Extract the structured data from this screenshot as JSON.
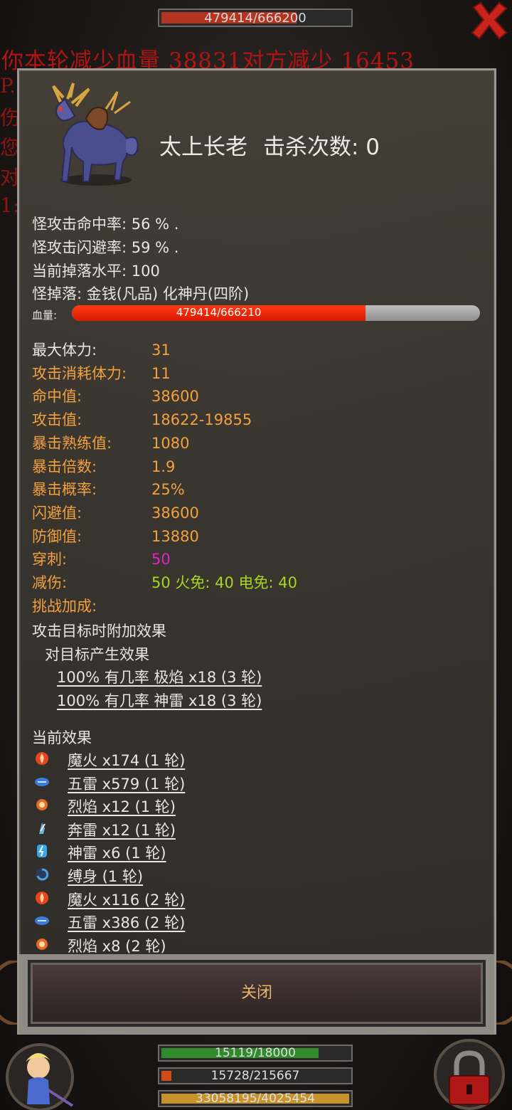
{
  "top_bar": {
    "hp_text": "479414/666200"
  },
  "background_text": {
    "combat_line": "你本轮减少血量   38831对方减少   16453",
    "side_chars": [
      "P.",
      "伤",
      "您",
      "对",
      "1:"
    ]
  },
  "monster": {
    "name": "太上长老",
    "kill_label": "击杀次数: 0",
    "info": [
      "怪攻击命中率: 56 % .",
      "怪攻击闪避率: 59 % .",
      "当前掉落水平: 100",
      "怪掉落: 金钱(凡品) 化神丹(四阶)"
    ],
    "hp_label": "血量:",
    "hp_text": "479414/666210",
    "hp_fraction": 0.72
  },
  "stats": [
    {
      "key": "最大体力:",
      "value": "31",
      "key_color": "white",
      "value_color": "orange"
    },
    {
      "key": "攻击消耗体力:",
      "value": "11",
      "key_color": "orange",
      "value_color": "orange"
    },
    {
      "key": "命中值:",
      "value": "38600",
      "key_color": "orange",
      "value_color": "orange"
    },
    {
      "key": "攻击值:",
      "value": "18622-19855",
      "key_color": "orange",
      "value_color": "orange"
    },
    {
      "key": "暴击熟练值:",
      "value": "1080",
      "key_color": "orange",
      "value_color": "orange"
    },
    {
      "key": "暴击倍数:",
      "value": "1.9",
      "key_color": "orange",
      "value_color": "orange"
    },
    {
      "key": "暴击概率:",
      "value": "25%",
      "key_color": "orange",
      "value_color": "orange"
    },
    {
      "key": "闪避值:",
      "value": "38600",
      "key_color": "orange",
      "value_color": "orange"
    },
    {
      "key": "防御值:",
      "value": "13880",
      "key_color": "orange",
      "value_color": "orange"
    },
    {
      "key": "穿刺:",
      "value": "50",
      "key_color": "orange",
      "value_color": "magenta"
    },
    {
      "key": "减伤:",
      "value": "50 火免: 40 电免: 40",
      "key_color": "orange",
      "value_color": "green"
    },
    {
      "key": "挑战加成:",
      "value": "",
      "key_color": "orange",
      "value_color": "orange"
    }
  ],
  "attack_effects": {
    "title": "攻击目标时附加效果",
    "subtitle": "对目标产生效果",
    "items": [
      "100% 有几率 极焰 x18 (3 轮)",
      "100% 有几率 神雷 x18 (3 轮)"
    ]
  },
  "current_effects": {
    "title": "当前效果",
    "items": [
      {
        "icon": "demon-fire-icon",
        "color": "#e8451f",
        "label": "魔火 x174 (1 轮)"
      },
      {
        "icon": "five-thunder-icon",
        "color": "#3d7be0",
        "label": "五雷 x579 (1 轮)"
      },
      {
        "icon": "blaze-icon",
        "color": "#e86a2a",
        "label": "烈焰 x12 (1 轮)"
      },
      {
        "icon": "rushing-thunder-icon",
        "color": "#6fb0d8",
        "label": "奔雷 x12 (1 轮)"
      },
      {
        "icon": "divine-thunder-icon",
        "color": "#39a8e8",
        "label": "神雷 x6 (1 轮)"
      },
      {
        "icon": "bind-icon",
        "color": "#4aa0e0",
        "label": "缚身 (1 轮)"
      },
      {
        "icon": "demon-fire-icon",
        "color": "#e8451f",
        "label": "魔火 x116 (2 轮)"
      },
      {
        "icon": "five-thunder-icon",
        "color": "#3d7be0",
        "label": "五雷 x386 (2 轮)"
      },
      {
        "icon": "blaze-icon",
        "color": "#e86a2a",
        "label": "烈焰 x8 (2 轮)"
      }
    ]
  },
  "close_button": "关闭",
  "bottom_bars": [
    {
      "text": "15119/18000",
      "fill_fraction": 0.84,
      "color": "#2f8a2a"
    },
    {
      "text": "15728/215667",
      "fill_fraction": 0.073,
      "color": "#d64a1a"
    },
    {
      "text": "33058195/4025454",
      "fill_fraction": 1.0,
      "color": "#c8922a"
    }
  ]
}
